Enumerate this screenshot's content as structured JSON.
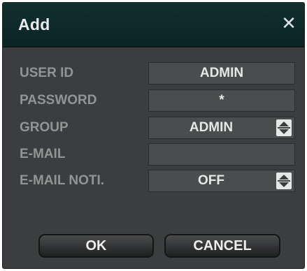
{
  "dialog": {
    "title": "Add",
    "close_label": "✕"
  },
  "form": {
    "user_id": {
      "label": "USER ID",
      "value": "ADMIN"
    },
    "password": {
      "label": "PASSWORD",
      "value": "*"
    },
    "group": {
      "label": "GROUP",
      "value": "ADMIN"
    },
    "email": {
      "label": "E-MAIL",
      "value": ""
    },
    "email_noti": {
      "label": "E-MAIL NOTI.",
      "value": "OFF"
    }
  },
  "buttons": {
    "ok_label": "OK",
    "cancel_label": "CANCEL"
  },
  "colors": {
    "titlebar": "#0a2523",
    "dialog_bg": "#3c3d3e",
    "field_bg": "#4b4c4d",
    "label_text": "#929495"
  }
}
